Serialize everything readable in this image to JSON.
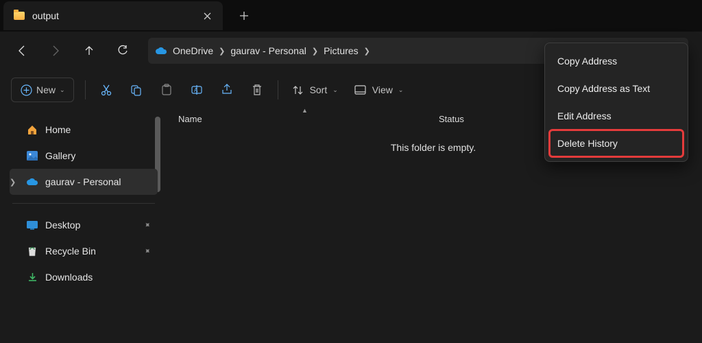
{
  "tab": {
    "title": "output"
  },
  "breadcrumb": {
    "items": [
      "OneDrive",
      "gaurav - Personal",
      "Pictures"
    ]
  },
  "toolbar": {
    "new_label": "New",
    "sort_label": "Sort",
    "view_label": "View"
  },
  "sidebar": {
    "home": "Home",
    "gallery": "Gallery",
    "personal": "gaurav - Personal",
    "desktop": "Desktop",
    "recycle": "Recycle Bin",
    "downloads": "Downloads"
  },
  "columns": {
    "name": "Name",
    "status": "Status"
  },
  "main": {
    "empty": "This folder is empty."
  },
  "context_menu": {
    "copy_address": "Copy Address",
    "copy_address_text": "Copy Address as Text",
    "edit_address": "Edit Address",
    "delete_history": "Delete History"
  }
}
